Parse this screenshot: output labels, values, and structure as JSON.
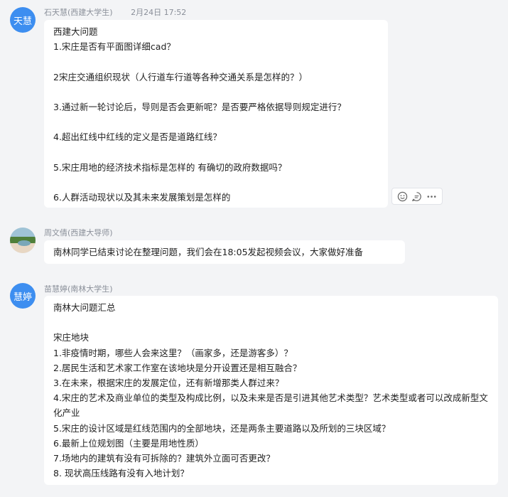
{
  "messages": [
    {
      "avatar_text": "天慧",
      "avatar_color": "#3d8ef0",
      "sender": "石天慧(西建大学生)",
      "time": "2月24日 17:52",
      "lines": [
        "西建大问题",
        "1.宋庄是否有平面图详细cad？",
        "",
        "2宋庄交通组织现状（人行道车行道等各种交通关系是怎样的？）",
        "",
        "3.通过新一轮讨论后，导则是否会更新呢？是否要严格依据导则规定进行？",
        "",
        "4.超出红线中红线的定义是否是道路红线？",
        "",
        "5.宋庄用地的经济技术指标是怎样的 有确切的政府数据吗？",
        "",
        "6.人群活动现状以及其未来发展策划是怎样的"
      ]
    },
    {
      "avatar_text": "",
      "avatar_color": "#7aa7b8",
      "sender": "周文倩(西建大导师)",
      "time": "",
      "lines": [
        "南林同学已结束讨论在整理问题，我们会在18:05发起视频会议，大家做好准备"
      ]
    },
    {
      "avatar_text": "慧婷",
      "avatar_color": "#3d8ef0",
      "sender": "苗慧婷(南林大学生)",
      "time": "",
      "lines": [
        "南林大问题汇总",
        "",
        "宋庄地块",
        "1.非疫情时期，哪些人会来这里？（画家多，还是游客多）？",
        "2.居民生活和艺术家工作室在该地块是分开设置还是相互融合？",
        "3.在未来，根据宋庄的发展定位，还有新增那类人群过来？",
        "4.宋庄的艺术及商业单位的类型及构成比例，以及未来是否是引进其他艺术类型？艺术类型或者可以改成新型文化产业",
        "5.宋庄的设计区域是红线范围内的全部地块，还是两条主要道路以及所划的三块区域？",
        "6.最新上位规划图（主要是用地性质）",
        "7.场地内的建筑有没有可拆除的？建筑外立面可否更改？",
        "8. 现状高压线路有没有入地计划？"
      ]
    }
  ],
  "actions": [
    "emoji-react",
    "reply",
    "more"
  ]
}
